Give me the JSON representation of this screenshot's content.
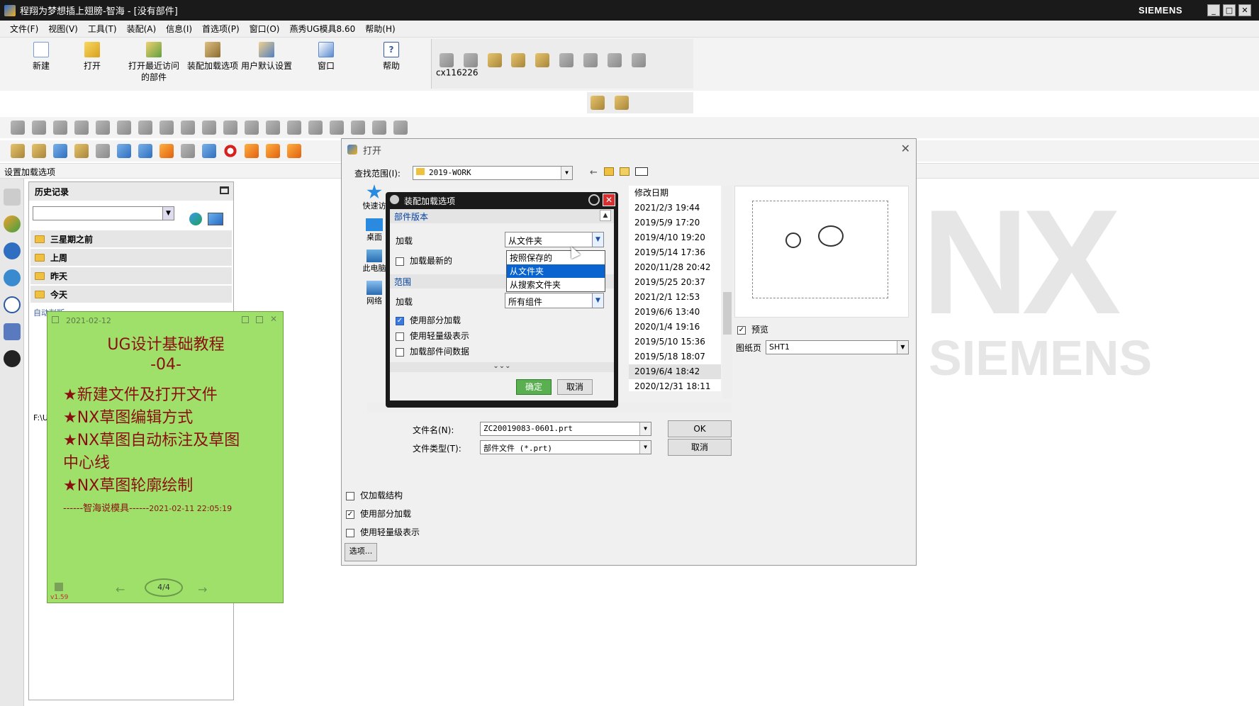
{
  "window": {
    "title": "程翔为梦想插上翅膀-智海 - [没有部件]",
    "brand": "SIEMENS",
    "min": "_",
    "max": "□",
    "close": "✕"
  },
  "menu": [
    "文件(F)",
    "视图(V)",
    "工具(T)",
    "装配(A)",
    "信息(I)",
    "首选项(P)",
    "窗口(O)",
    "燕秀UG模具8.60",
    "帮助(H)"
  ],
  "ribbon": {
    "new": "新建",
    "open": "打开",
    "recent_line1": "打开最近访问",
    "recent_line2": "的部件",
    "asm_load": "装配加载选项",
    "user_default": "用户默认设置",
    "window": "窗口",
    "help": "帮助",
    "user": "cx116226"
  },
  "status_label": "设置加载选项",
  "history": {
    "title": "历史记录",
    "groups": [
      "三星期之前",
      "上周",
      "昨天",
      "今天"
    ],
    "auto_label": "自动判断",
    "path_fragment": "F:\\U"
  },
  "note": {
    "date": "2021-02-12",
    "title_line1": "UG设计基础教程",
    "title_line2": "-04-",
    "items": [
      "★新建文件及打开文件",
      "★NX草图编辑方式",
      "★NX草图自动标注及草图",
      "中心线",
      "★NX草图轮廓绘制"
    ],
    "signature": "------智海说模具------",
    "timestamp": "2021-02-11 22:05:19",
    "pager": "4/4",
    "version": "v1.59"
  },
  "open_dialog": {
    "title": "打开",
    "lookin_label": "查找范围(I):",
    "lookin_value": "2019-WORK",
    "places": [
      "快速访",
      "桌面",
      "此电脑",
      "网络"
    ],
    "date_header": "修改日期",
    "dates": [
      "2021/2/3 19:44",
      "2019/5/9 17:20",
      "2019/4/10 19:20",
      "2019/5/14 17:36",
      "2020/11/28 20:42",
      "2019/5/25 20:37",
      "2021/2/1 12:53",
      "2019/6/6 13:40",
      "2020/1/4 19:16",
      "2019/5/10 15:36",
      "2019/5/18 18:07",
      "2019/6/4 18:42",
      "2020/12/31 18:11"
    ],
    "selected_index": 11,
    "preview_label": "预览",
    "sheet_label": "图纸页",
    "sheet_value": "SHT1",
    "filename_label": "文件名(N):",
    "filename_value": "ZC20019083-0601.prt",
    "filetype_label": "文件类型(T):",
    "filetype_value": "部件文件 (*.prt)",
    "ok": "OK",
    "cancel": "取消",
    "only_structure": "仅加载结构",
    "partial_load": "使用部分加载",
    "lightweight": "使用轻量级表示",
    "options": "选项..."
  },
  "asm_dialog": {
    "title": "装配加载选项",
    "section1": "部件版本",
    "load_label": "加载",
    "load_value": "从文件夹",
    "load_latest": "加载最新的",
    "dropdown_options": [
      "按照保存的",
      "从文件夹",
      "从搜索文件夹"
    ],
    "dropdown_selected": 1,
    "section2": "范围",
    "load_label2": "加载",
    "scope_value": "所有组件",
    "use_partial": "使用部分加载",
    "use_light": "使用轻量级表示",
    "load_interpart": "加载部件间数据",
    "ok": "确定",
    "cancel": "取消"
  },
  "watermark": {
    "nx": "NX",
    "siemens": "SIEMENS"
  }
}
